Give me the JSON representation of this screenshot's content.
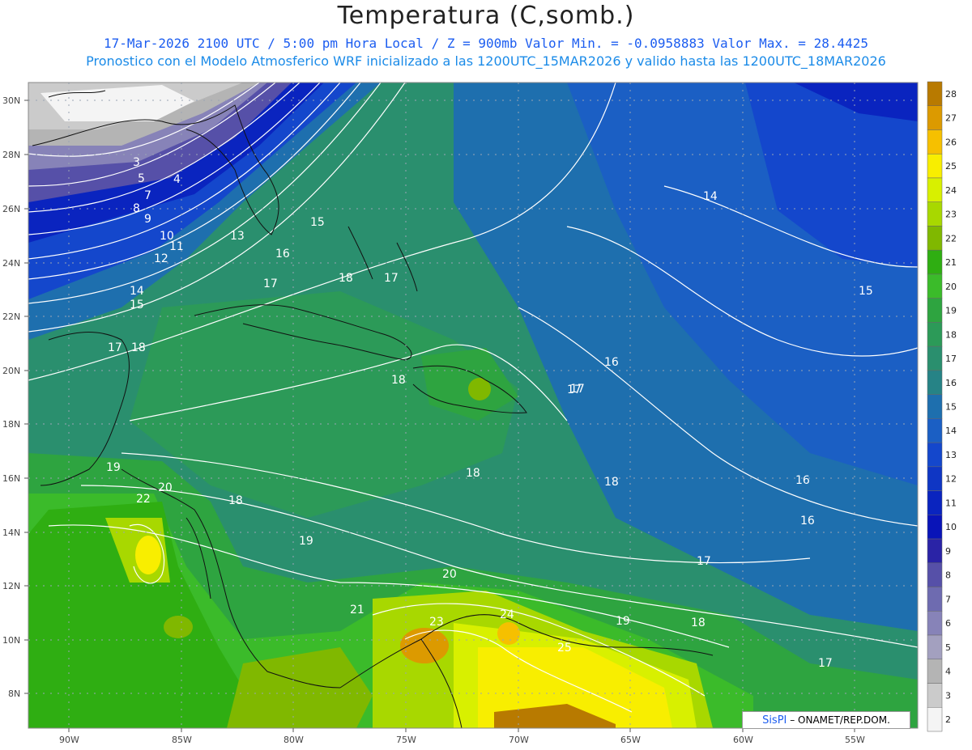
{
  "header": {
    "title": "Temperatura (C,somb.)",
    "line1": "17-Mar-2026  2100 UTC / 5:00 pm Hora Local / Z = 900mb  Valor Min. = -0.0958883  Valor Max. = 28.4425",
    "line2": "Pronostico con el Modelo Atmosferico WRF inicializado a las 1200UTC_15MAR2026 y valido hasta las  1200UTC_18MAR2026"
  },
  "axes": {
    "lat_labels": [
      "30N",
      "28N",
      "26N",
      "24N",
      "22N",
      "20N",
      "18N",
      "16N",
      "14N",
      "12N",
      "10N",
      "8N"
    ],
    "lon_labels": [
      "90W",
      "85W",
      "80W",
      "75W",
      "70W",
      "65W",
      "60W",
      "55W"
    ]
  },
  "colorbar": {
    "levels": [
      "28",
      "27",
      "26",
      "25",
      "24",
      "23",
      "22",
      "21",
      "20",
      "19",
      "18",
      "17",
      "16",
      "15",
      "14",
      "13",
      "12",
      "11",
      "10",
      "9",
      "8",
      "7",
      "6",
      "5",
      "4",
      "3",
      "2"
    ],
    "colors": [
      "#b87a00",
      "#dc9a00",
      "#f6c000",
      "#f8ee00",
      "#d8f000",
      "#a8d800",
      "#80b800",
      "#2fae12",
      "#3bbb2a",
      "#2ea440",
      "#2c9a58",
      "#2a8f6e",
      "#268386",
      "#1e6fae",
      "#1b5fc4",
      "#1447cc",
      "#0f36c4",
      "#0a24bf",
      "#0914b8",
      "#2a23a6",
      "#5650a8",
      "#6e6bb0",
      "#8783b8",
      "#a3a0bf",
      "#b4b4b4",
      "#cbcbcb",
      "#f4f4f4"
    ]
  },
  "contour_labels": [
    "3",
    "5",
    "4",
    "7",
    "8",
    "9",
    "10",
    "11",
    "12",
    "13",
    "14",
    "15",
    "15",
    "16",
    "17",
    "18",
    "17",
    "14",
    "15",
    "17",
    "18",
    "18",
    "16",
    "17",
    "19",
    "18",
    "20",
    "22",
    "18",
    "19",
    "18",
    "17",
    "16",
    "16",
    "17",
    "20",
    "21",
    "24",
    "23",
    "25",
    "19",
    "18",
    "17"
  ],
  "credit": {
    "brand": "SisPI",
    "text": "– ONAMET/REP.DOM."
  }
}
